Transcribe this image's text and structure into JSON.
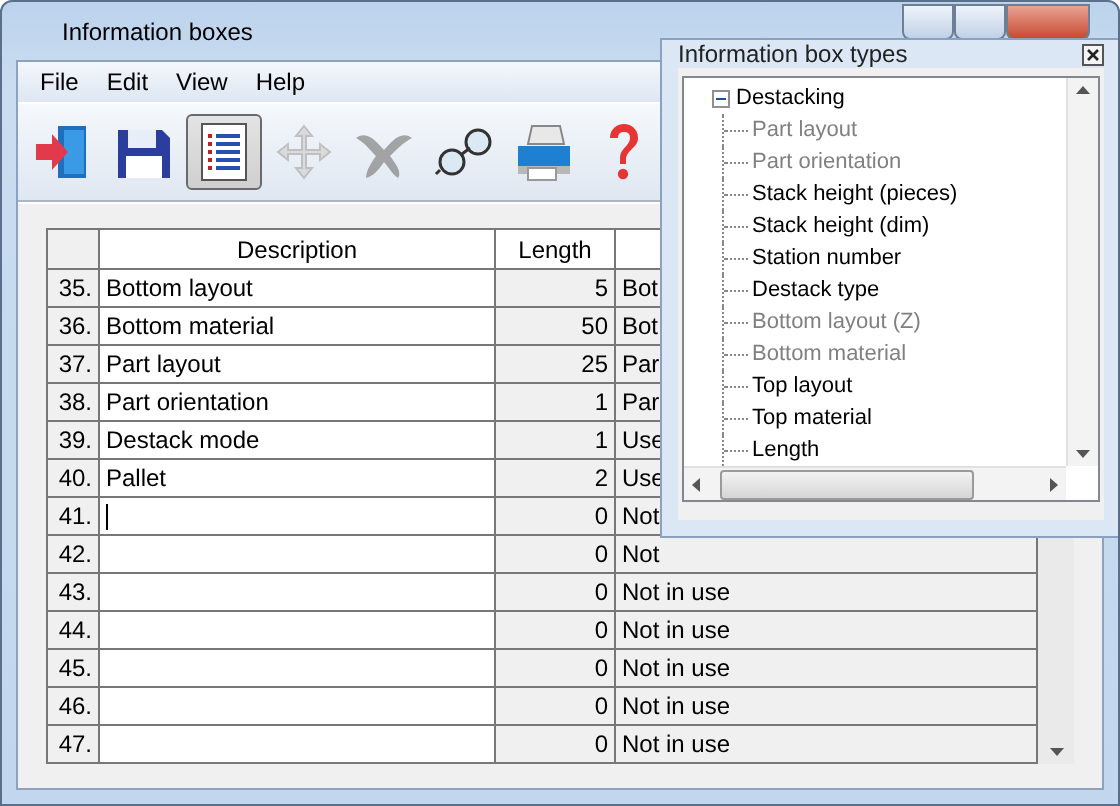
{
  "window": {
    "title": "Information boxes"
  },
  "menu": [
    "File",
    "Edit",
    "View",
    "Help"
  ],
  "toolbar": [
    {
      "kind": "exit",
      "selected": false,
      "disabled": false
    },
    {
      "kind": "save",
      "selected": false,
      "disabled": false
    },
    {
      "kind": "list",
      "selected": true,
      "disabled": false
    },
    {
      "kind": "move",
      "selected": false,
      "disabled": true
    },
    {
      "kind": "delete",
      "selected": false,
      "disabled": true
    },
    {
      "kind": "view",
      "selected": false,
      "disabled": false
    },
    {
      "kind": "print",
      "selected": false,
      "disabled": false
    },
    {
      "kind": "help",
      "selected": false,
      "disabled": false
    }
  ],
  "table": {
    "columns": [
      "Description",
      "Length"
    ],
    "rows": [
      {
        "number": "35.",
        "description": "Bottom layout",
        "length": "5",
        "column_3": "Bot",
        "editing": false
      },
      {
        "number": "36.",
        "description": "Bottom material",
        "length": "50",
        "column_3": "Bot",
        "editing": false
      },
      {
        "number": "37.",
        "description": "Part layout",
        "length": "25",
        "column_3": "Par",
        "editing": false
      },
      {
        "number": "38.",
        "description": "Part orientation",
        "length": "1",
        "column_3": "Par",
        "editing": false
      },
      {
        "number": "39.",
        "description": "Destack mode",
        "length": "1",
        "column_3": "Use",
        "editing": false
      },
      {
        "number": "40.",
        "description": "Pallet",
        "length": "2",
        "column_3": "Use",
        "editing": false
      },
      {
        "number": "41.",
        "description": "",
        "length": "0",
        "column_3": "Not",
        "editing": true
      },
      {
        "number": "42.",
        "description": "",
        "length": "0",
        "column_3": "Not",
        "editing": false
      },
      {
        "number": "43.",
        "description": "",
        "length": "0",
        "column_3": "Not in use",
        "editing": false
      },
      {
        "number": "44.",
        "description": "",
        "length": "0",
        "column_3": "Not in use",
        "editing": false
      },
      {
        "number": "45.",
        "description": "",
        "length": "0",
        "column_3": "Not in use",
        "editing": false
      },
      {
        "number": "46.",
        "description": "",
        "length": "0",
        "column_3": "Not in use",
        "editing": false
      },
      {
        "number": "47.",
        "description": "",
        "length": "0",
        "column_3": "Not in use",
        "editing": false
      }
    ]
  },
  "info_box_types": {
    "title": "Information box types",
    "tree": [
      {
        "label": "Destacking",
        "expanded": true,
        "children": [
          {
            "label": "Part layout",
            "disabled": true
          },
          {
            "label": "Part orientation",
            "disabled": true
          },
          {
            "label": "Stack height (pieces)",
            "disabled": false
          },
          {
            "label": "Stack height (dim)",
            "disabled": false
          },
          {
            "label": "Station number",
            "disabled": false
          },
          {
            "label": "Destack type",
            "disabled": false
          },
          {
            "label": "Bottom layout (Z)",
            "disabled": true
          },
          {
            "label": "Bottom material",
            "disabled": true
          },
          {
            "label": "Top layout",
            "disabled": false
          },
          {
            "label": "Top material",
            "disabled": false
          },
          {
            "label": "Length",
            "disabled": false
          }
        ]
      }
    ]
  }
}
